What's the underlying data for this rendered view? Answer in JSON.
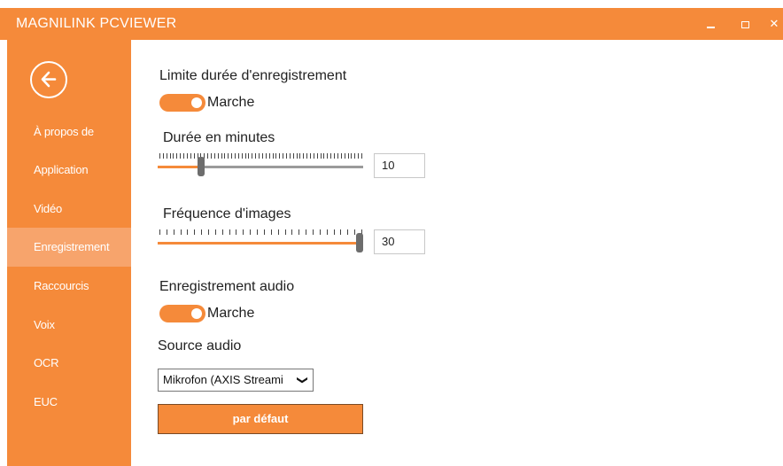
{
  "window": {
    "title": "MAGNILINK PCVIEWER",
    "accent_color": "#f58a3a",
    "controls": {
      "minimize": "minimize-icon",
      "maximize": "maximize-icon",
      "close": "close-icon"
    }
  },
  "sidebar": {
    "back_icon": "back-arrow-icon",
    "items": [
      {
        "label": "À propos de",
        "active": false
      },
      {
        "label": "Application",
        "active": false
      },
      {
        "label": "Vidéo",
        "active": false
      },
      {
        "label": "Enregistrement",
        "active": true
      },
      {
        "label": "Raccourcis",
        "active": false
      },
      {
        "label": "Voix",
        "active": false
      },
      {
        "label": "OCR",
        "active": false
      },
      {
        "label": "EUC",
        "active": false
      }
    ]
  },
  "settings": {
    "limit_duration": {
      "label": "Limite durée d'enregistrement",
      "state_text": "Marche",
      "on": true
    },
    "duration_minutes": {
      "label": "Durée en minutes",
      "value": "10",
      "slider_fraction": 0.2
    },
    "frame_rate": {
      "label": "Fréquence d'images",
      "value": "30",
      "slider_fraction": 1.0
    },
    "audio_recording": {
      "label": "Enregistrement audio",
      "state_text": "Marche",
      "on": true
    },
    "audio_source": {
      "label": "Source audio",
      "selected": "Mikrofon (AXIS Streami"
    },
    "default_button": {
      "label": "par défaut"
    }
  }
}
